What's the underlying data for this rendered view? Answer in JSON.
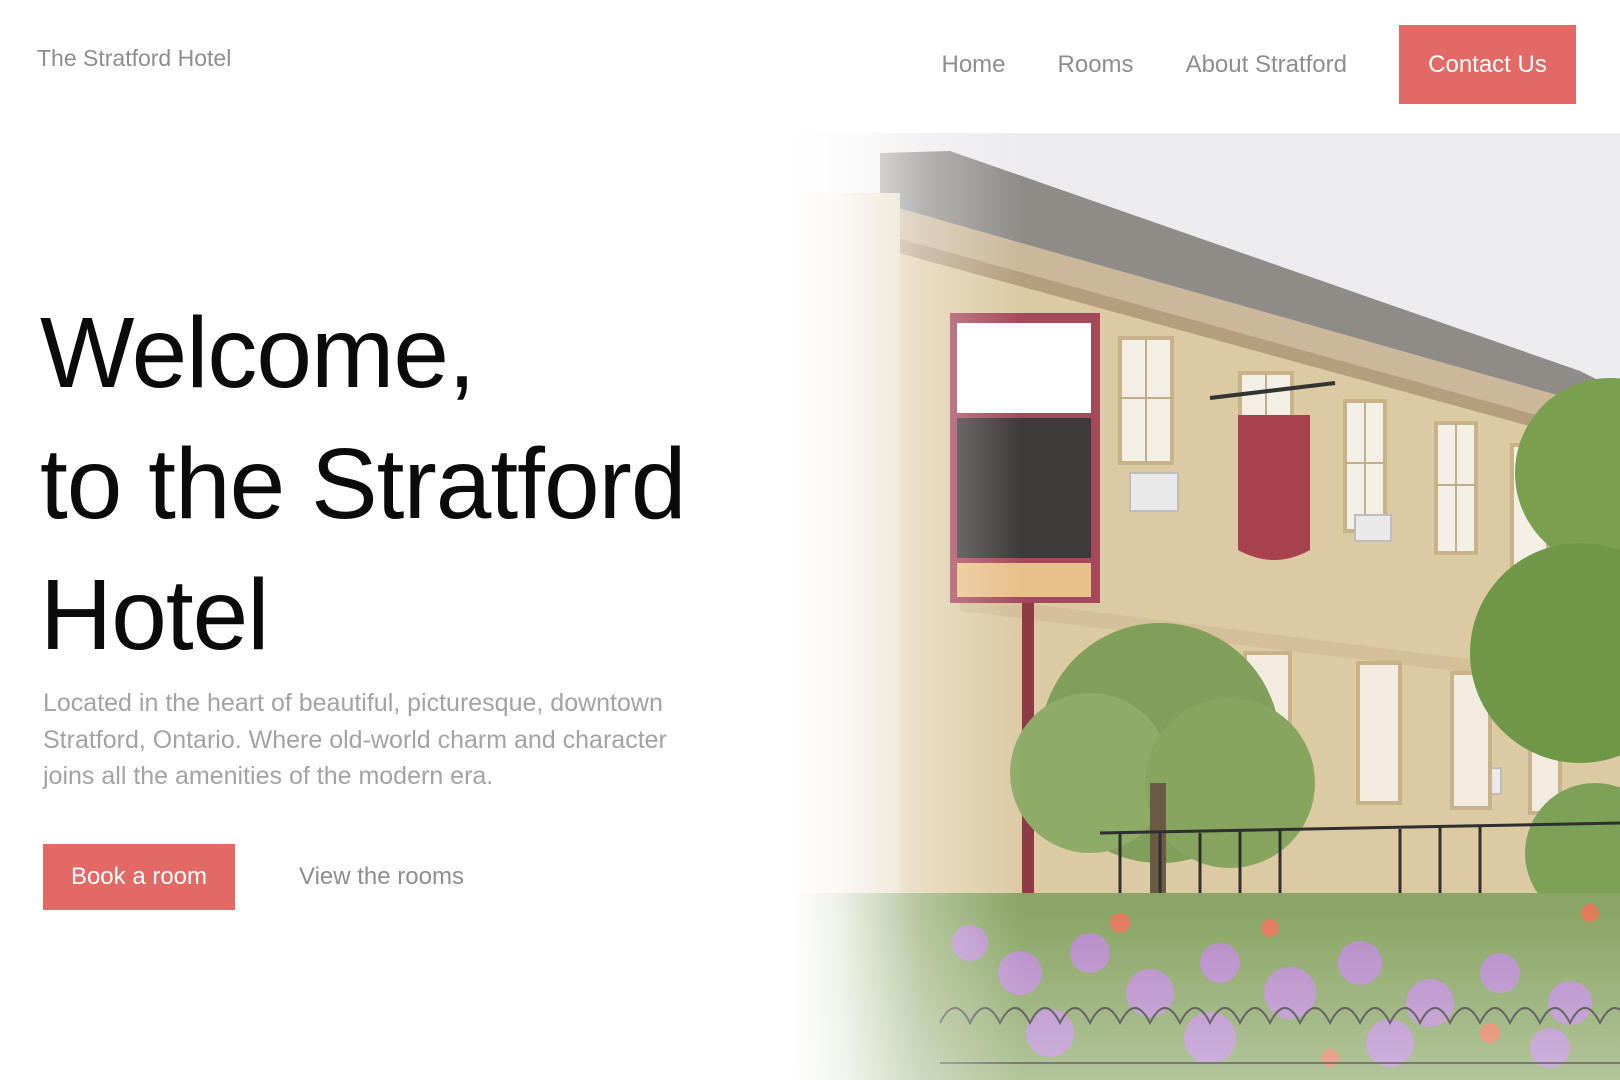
{
  "header": {
    "brand": "The Stratford Hotel",
    "nav": {
      "home": "Home",
      "rooms": "Rooms",
      "about": "About Stratford",
      "contact": "Contact Us"
    }
  },
  "hero": {
    "headline_lines": [
      "Welcome,",
      "to the Stratford",
      "Hotel"
    ],
    "lede": "Located in the heart of beautiful, picturesque, downtown Stratford, Ontario. Where old-world charm and character joins all the amenities of the modern era.",
    "primary_cta": "Book a room",
    "secondary_cta": "View the rooms"
  },
  "colors": {
    "accent": "#e36a64",
    "nav_text": "#8e8e8e",
    "headline": "#0b0b0b",
    "lede_text": "#a3a3a3"
  }
}
